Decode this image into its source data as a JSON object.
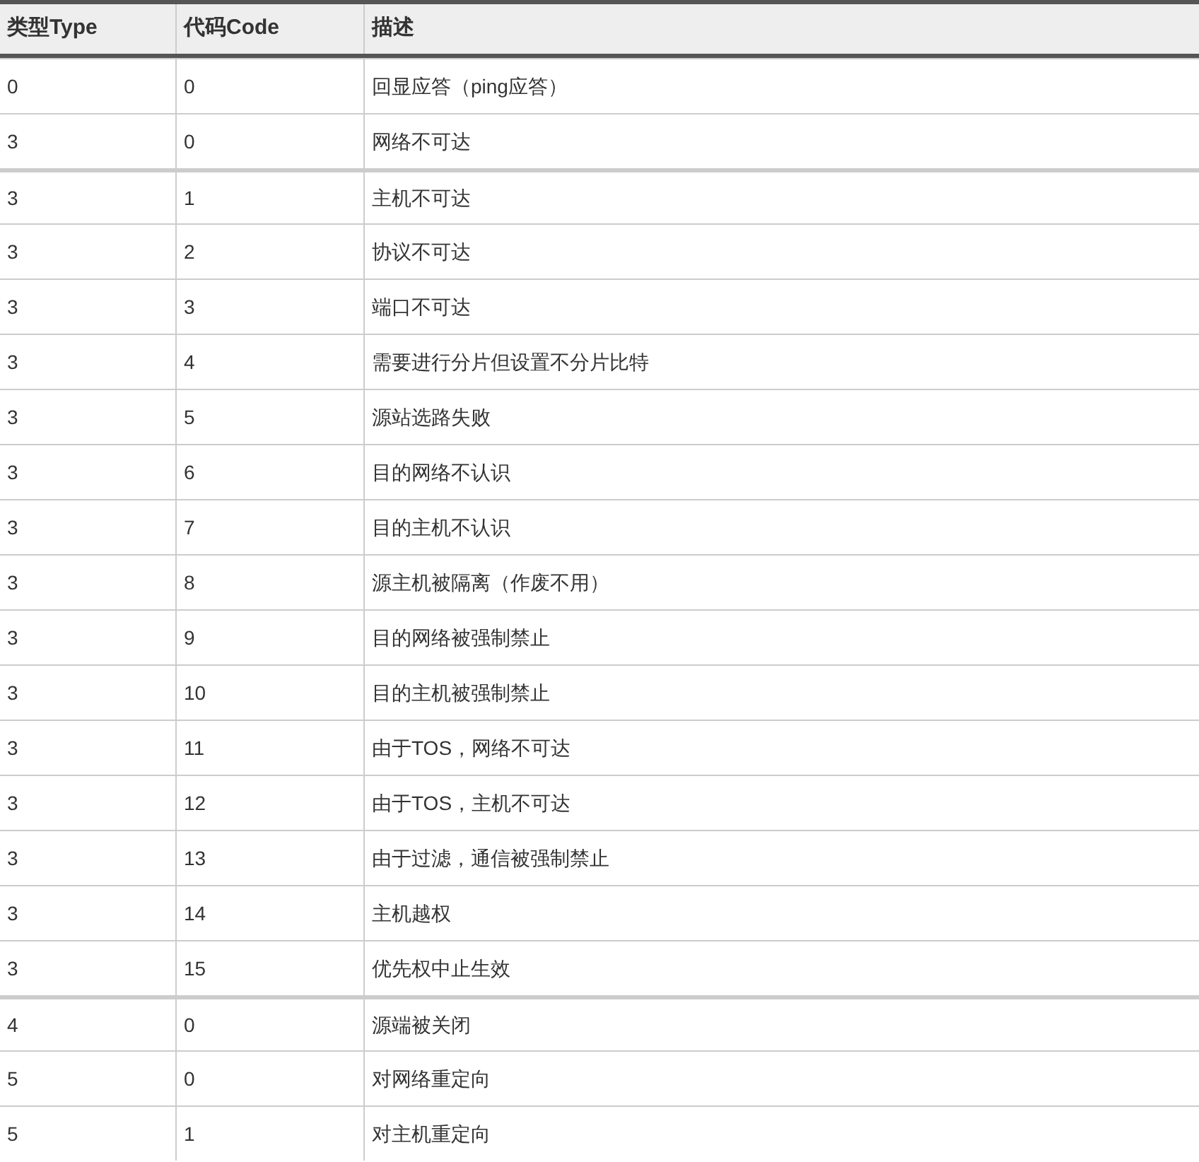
{
  "table": {
    "columns": [
      "类型Type",
      "代码Code",
      "描述"
    ],
    "rows": [
      {
        "cells": [
          "0",
          "0",
          "回显应答（ping应答）"
        ],
        "divider_above": false
      },
      {
        "cells": [
          "3",
          "0",
          "网络不可达"
        ],
        "divider_above": false
      },
      {
        "cells": [
          "3",
          "1",
          "主机不可达"
        ],
        "divider_above": true
      },
      {
        "cells": [
          "3",
          "2",
          "协议不可达"
        ],
        "divider_above": false
      },
      {
        "cells": [
          "3",
          "3",
          "端口不可达"
        ],
        "divider_above": false
      },
      {
        "cells": [
          "3",
          "4",
          "需要进行分片但设置不分片比特"
        ],
        "divider_above": false
      },
      {
        "cells": [
          "3",
          "5",
          "源站选路失败"
        ],
        "divider_above": false
      },
      {
        "cells": [
          "3",
          "6",
          "目的网络不认识"
        ],
        "divider_above": false
      },
      {
        "cells": [
          "3",
          "7",
          "目的主机不认识"
        ],
        "divider_above": false
      },
      {
        "cells": [
          "3",
          "8",
          "源主机被隔离（作废不用）"
        ],
        "divider_above": false
      },
      {
        "cells": [
          "3",
          "9",
          "目的网络被强制禁止"
        ],
        "divider_above": false
      },
      {
        "cells": [
          "3",
          "10",
          "目的主机被强制禁止"
        ],
        "divider_above": false
      },
      {
        "cells": [
          "3",
          "11",
          "由于TOS，网络不可达"
        ],
        "divider_above": false
      },
      {
        "cells": [
          "3",
          "12",
          "由于TOS，主机不可达"
        ],
        "divider_above": false
      },
      {
        "cells": [
          "3",
          "13",
          "由于过滤，通信被强制禁止"
        ],
        "divider_above": false
      },
      {
        "cells": [
          "3",
          "14",
          "主机越权"
        ],
        "divider_above": false
      },
      {
        "cells": [
          "3",
          "15",
          "优先权中止生效"
        ],
        "divider_above": false
      },
      {
        "cells": [
          "4",
          "0",
          "源端被关闭"
        ],
        "divider_above": true
      },
      {
        "cells": [
          "5",
          "0",
          "对网络重定向"
        ],
        "divider_above": false
      },
      {
        "cells": [
          "5",
          "1",
          "对主机重定向"
        ],
        "divider_above": false
      }
    ]
  }
}
